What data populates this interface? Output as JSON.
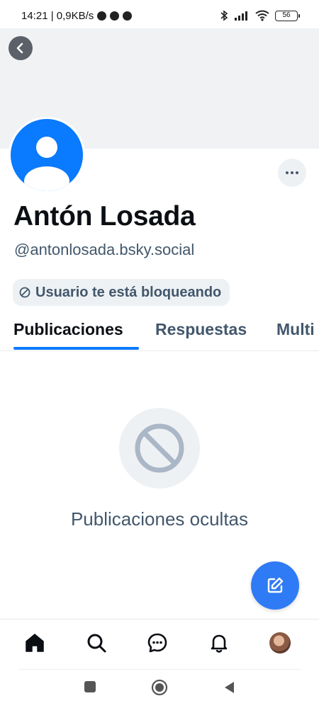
{
  "status_bar": {
    "time_and_speed": "14:21 | 0,9KB/s",
    "battery": "56"
  },
  "profile": {
    "display_name": "Antón Losada",
    "handle": "@antonlosada.bsky.social",
    "blocked_label": "Usuario te está bloqueando"
  },
  "tabs": [
    {
      "label": "Publicaciones",
      "active": true
    },
    {
      "label": "Respuestas",
      "active": false
    },
    {
      "label": "Multi",
      "active": false
    }
  ],
  "empty_state": {
    "message": "Publicaciones ocultas"
  },
  "colors": {
    "accent": "#0a7aff",
    "fab": "#2f7bf5",
    "muted_text": "#42576c",
    "banner": "#f0f2f4"
  },
  "icons": {
    "back": "chevron-left-icon",
    "more": "ellipsis-icon",
    "blocked": "block-icon",
    "compose": "edit-icon",
    "nav": [
      "home-icon",
      "search-icon",
      "chat-icon",
      "bell-icon",
      "profile-avatar"
    ],
    "system": [
      "recents-square-icon",
      "home-circle-icon",
      "back-triangle-icon"
    ]
  }
}
